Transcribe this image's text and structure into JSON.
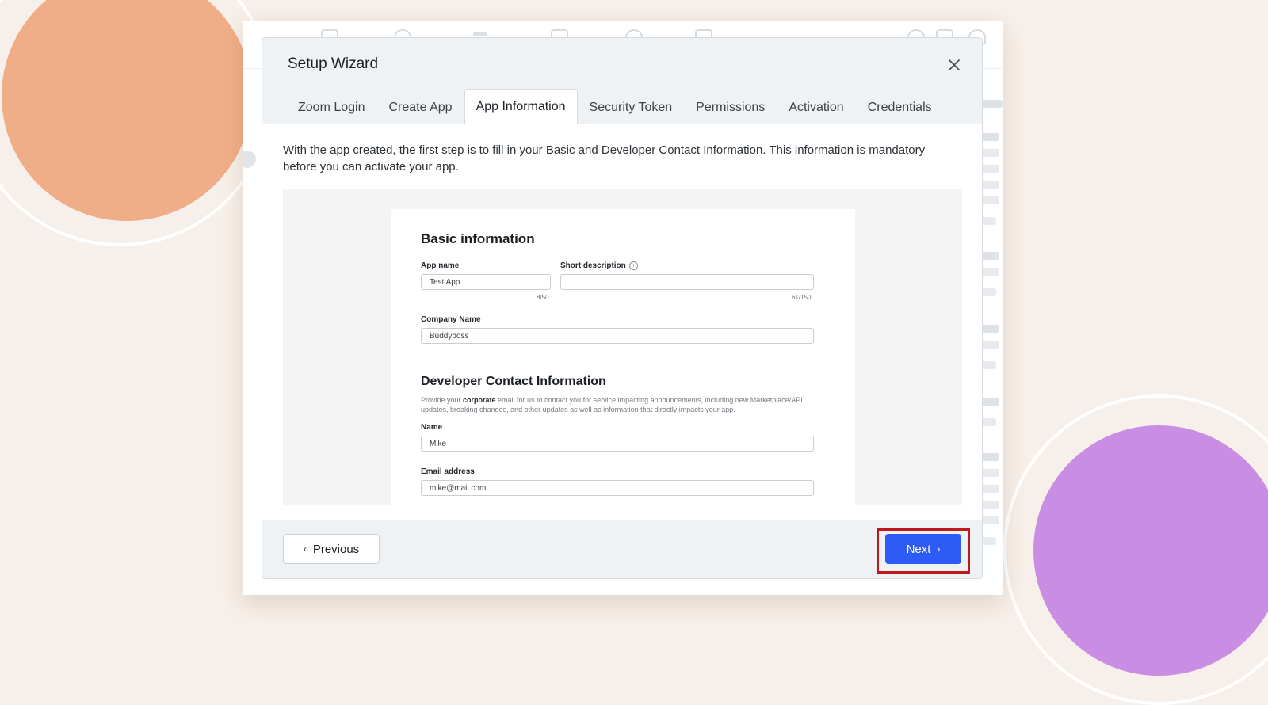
{
  "modal": {
    "title": "Setup Wizard",
    "tabs": [
      {
        "label": "Zoom Login"
      },
      {
        "label": "Create App"
      },
      {
        "label": "App Information",
        "active": true
      },
      {
        "label": "Security Token"
      },
      {
        "label": "Permissions"
      },
      {
        "label": "Activation"
      },
      {
        "label": "Credentials"
      }
    ],
    "intro": "With the app created, the first step is to fill in your Basic and Developer Contact Information. This information is mandatory before you can activate your app."
  },
  "preview_form": {
    "basic_heading": "Basic information",
    "app_name_label": "App name",
    "app_name_value": "Test App",
    "app_name_count": "8/50",
    "short_desc_label": "Short description",
    "short_desc_value": "",
    "short_desc_count": "61/150",
    "company_label": "Company Name",
    "company_value": "Buddyboss",
    "dev_heading": "Developer Contact Information",
    "dev_desc_prefix": "Provide your ",
    "dev_desc_bold": "corporate",
    "dev_desc_suffix": " email for us to contact you for service impacting announcements, including new Marketplace/API updates, breaking changes, and other updates as well as information that directly impacts your app.",
    "name_label": "Name",
    "name_value": "Mike",
    "email_label": "Email address",
    "email_value": "mike@mail.com"
  },
  "footer": {
    "previous_label": "Previous",
    "next_label": "Next"
  },
  "colors": {
    "background": "#f7efe9",
    "accent_orange": "#f0ae88",
    "accent_purple": "#c98ee3",
    "primary_button": "#2e5bf5",
    "highlight": "#c0181c"
  },
  "icons": {
    "close": "close-icon",
    "previous": "chevron-left-icon",
    "next": "chevron-right-icon",
    "info": "info-icon"
  }
}
